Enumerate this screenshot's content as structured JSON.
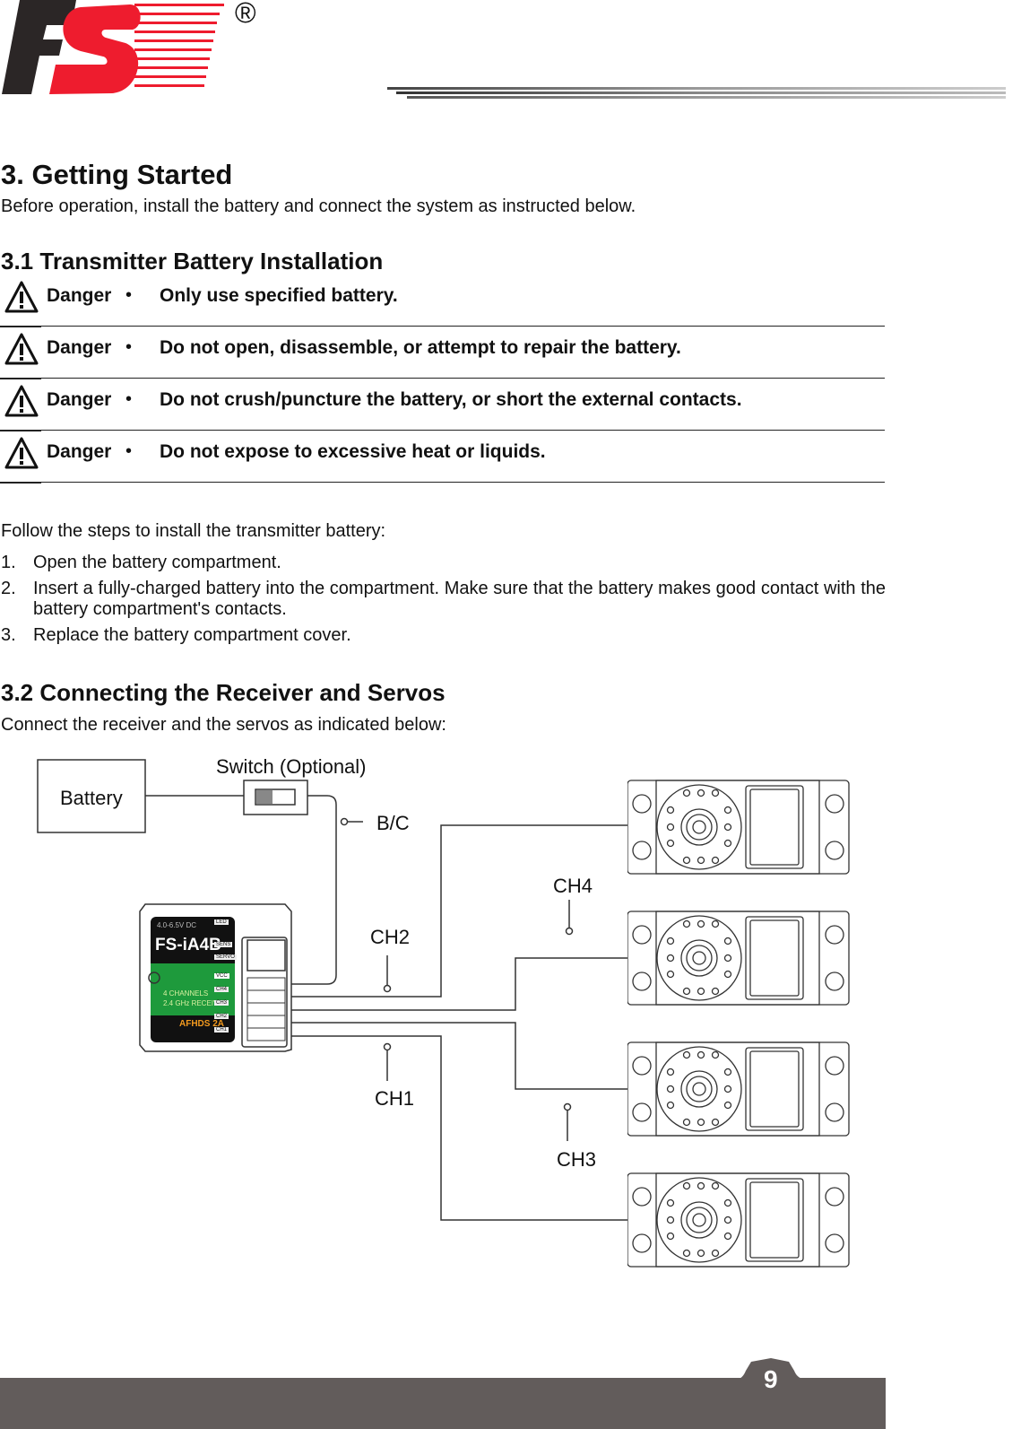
{
  "header": {
    "logo_text": "FS",
    "registered_mark": "®"
  },
  "section3": {
    "title": "3. Getting Started",
    "intro": "Before operation, install the battery and connect the system as instructed below."
  },
  "section31": {
    "title": "3.1 Transmitter Battery Installation",
    "warnings": [
      {
        "label": "Danger",
        "bullet": "•",
        "text": "Only use specified battery."
      },
      {
        "label": "Danger",
        "bullet": "•",
        "text": "Do not open, disassemble, or attempt to repair the battery."
      },
      {
        "label": "Danger",
        "bullet": "•",
        "text": "Do not crush/puncture the battery, or short the external contacts."
      },
      {
        "label": "Danger",
        "bullet": "•",
        "text": "Do not expose to excessive heat or liquids."
      }
    ],
    "steps_intro": "Follow the steps to install the transmitter battery:",
    "steps": [
      {
        "n": "1.",
        "text": "Open the battery compartment."
      },
      {
        "n": "2.",
        "text": "Insert a fully-charged battery into the compartment. Make sure that the battery makes good contact with the battery compartment's contacts."
      },
      {
        "n": "3.",
        "text": "Replace the battery compartment cover."
      }
    ]
  },
  "section32": {
    "title": "3.2 Connecting the Receiver and Servos",
    "intro": "Connect the receiver and the servos as indicated below:",
    "diagram": {
      "battery": "Battery",
      "switch": "Switch (Optional)",
      "bc": "B/C",
      "ch1": "CH1",
      "ch2": "CH2",
      "ch3": "CH3",
      "ch4": "CH4",
      "receiver": {
        "model": "FS-iA4B",
        "line1": "4 CHANNELS",
        "line2": "2.4 GHz RECEIVER",
        "afhds": "AFHDS 2A",
        "voltage": "4.0-6.5V DC",
        "ports": [
          "LED",
          "SENS",
          "SERVO",
          "VCC",
          "CH4",
          "CH3",
          "CH2",
          "CH1"
        ]
      }
    }
  },
  "footer": {
    "page_number": "9"
  },
  "colors": {
    "brand_red": "#ee1c2e",
    "footer_gray": "#625c5b",
    "receiver_green": "#1e9a3c"
  }
}
